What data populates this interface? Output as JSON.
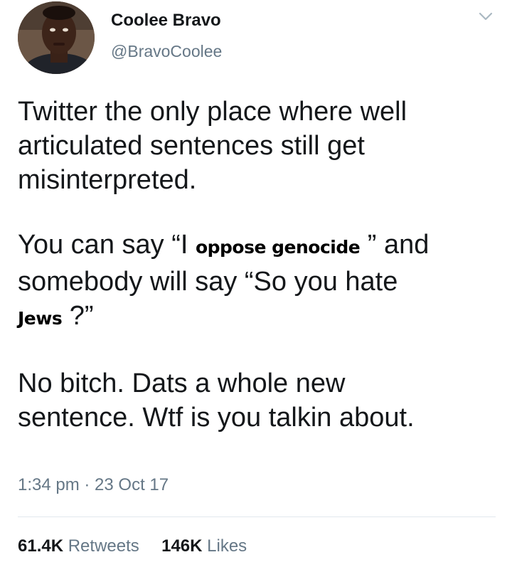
{
  "author": {
    "display_name": "Coolee Bravo",
    "handle": "@BravoCoolee"
  },
  "tweet": {
    "line1": "Twitter the only place where well\narticulated sentences still get\nmisinterpreted.",
    "p2_before": "You can say “I ",
    "p2_sticker1": "oppose genocide",
    "p2_middle": " ” and\nsomebody will say “So you hate\n    ",
    "p2_sticker2": "Jews",
    "p2_after": "    ?”",
    "line3": "No bitch. Dats a whole new\nsentence. Wtf is you talkin about."
  },
  "timestamp": "1:34 pm · 23 Oct 17",
  "stats": {
    "retweets_count": "61.4K",
    "retweets_label": "Retweets",
    "likes_count": "146K",
    "likes_label": "Likes"
  },
  "icons": {
    "menu": "chevron-down-icon"
  }
}
